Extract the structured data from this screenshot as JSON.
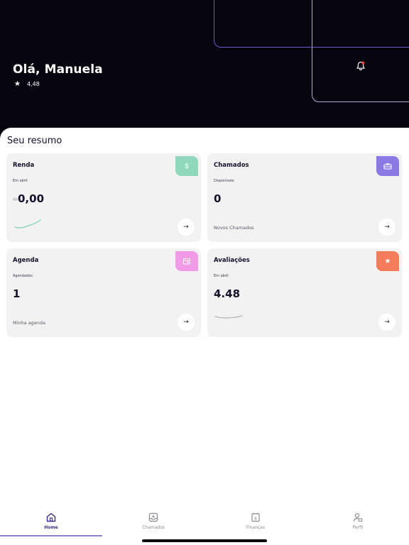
{
  "header": {
    "greeting": "Olá, Manuela",
    "rating": "4,48"
  },
  "summary": {
    "title": "Seu resumo",
    "cards": [
      {
        "title": "Renda",
        "subtitle": "Em abril",
        "value": "0,00",
        "footer": "",
        "badge_icon": "dollar-icon",
        "badge_color": "#8fd8bd"
      },
      {
        "title": "Chamados",
        "subtitle": "Disponíveis",
        "value": "0",
        "footer": "Novos Chamados",
        "badge_icon": "briefcase-icon",
        "badge_color": "#8b7ae6"
      },
      {
        "title": "Agenda",
        "subtitle": "Agendados",
        "value": "1",
        "footer": "Minha agenda",
        "badge_icon": "calendar-icon",
        "badge_color": "#f29ae6"
      },
      {
        "title": "Avaliações",
        "subtitle": "Em abril",
        "value": "4.48",
        "footer": "",
        "badge_icon": "star-icon",
        "badge_color": "#f47c5a"
      }
    ]
  },
  "tabs": [
    {
      "label": "Home",
      "icon": "home-icon",
      "active": true
    },
    {
      "label": "Chamados",
      "icon": "inbox-icon",
      "active": false
    },
    {
      "label": "Finanças",
      "icon": "finance-icon",
      "active": false
    },
    {
      "label": "Perfil",
      "icon": "profile-icon",
      "active": false
    }
  ],
  "colors": {
    "hero_bg": "#06040f",
    "accent": "#3a2f8a",
    "card_bg": "#f2f2f3"
  }
}
